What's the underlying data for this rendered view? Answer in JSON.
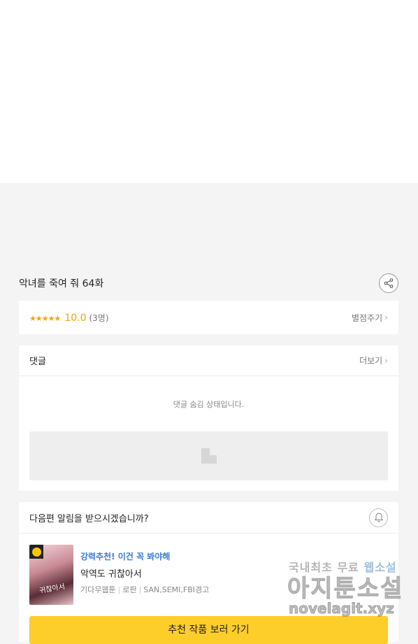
{
  "episode": {
    "title": "악녀를 죽여 줘 64화"
  },
  "rating": {
    "stars": "★★★★★",
    "score": "10.0",
    "count": "(3명)",
    "rate_label": "별점주기"
  },
  "comments": {
    "title": "댓글",
    "more_label": "더보기",
    "hidden_message": "댓글 숨김 상태입니다."
  },
  "notify": {
    "question": "다음편 알림을 받으시겠습니까?"
  },
  "recommend": {
    "tag": "강력추천! 이건 꼭 봐야해",
    "work_title": "악역도 귀찮아서",
    "meta": [
      "기다무웹툰",
      "로판",
      "SAN,SEMI,FBI경고"
    ],
    "thumb_title": "귀찮아서",
    "cta_label": "추천 작품 보러 가기"
  },
  "watermark": {
    "line1_a": "국내최초 무료 ",
    "line1_b": "웹소설",
    "line2": "아지툰소설",
    "line3": "novelagit.xyz"
  },
  "colors": {
    "accent_star": "#f5a20a",
    "cta": "#fdcd2a",
    "tag_blue": "#3a7bd5"
  },
  "icons": {
    "share": "share-icon",
    "bell": "bell-icon",
    "chevron": "chevron-right-icon",
    "clock_badge": "clock-badge-icon",
    "ad_placeholder": "image-placeholder-icon"
  }
}
